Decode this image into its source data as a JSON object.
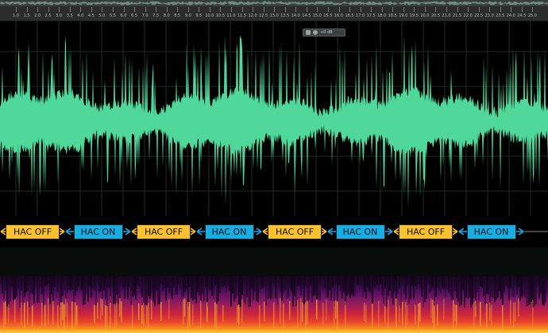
{
  "ruler": {
    "ticks": [
      "1.0",
      "1.5",
      "2.0",
      "2.5",
      "3.0",
      "3.5",
      "4.0",
      "4.5",
      "5.0",
      "5.5",
      "6.0",
      "6.5",
      "7.0",
      "7.5",
      "8.0",
      "8.5",
      "9.0",
      "9.5",
      "10.0",
      "10.5",
      "11.0",
      "11.5",
      "12.0",
      "12.5",
      "13.0",
      "13.5",
      "14.0",
      "14.5",
      "15.0",
      "15.5",
      "16.0",
      "16.5",
      "17.0",
      "17.5",
      "18.0",
      "18.5",
      "19.0",
      "19.5",
      "20.0",
      "20.5",
      "21.0",
      "21.5",
      "22.0",
      "22.5",
      "23.0",
      "23.5",
      "24.0",
      "24.5",
      "25.0"
    ]
  },
  "hud": {
    "label": "+0 dB"
  },
  "markers": {
    "segments": [
      {
        "label": "HAC OFF",
        "state": "off"
      },
      {
        "label": "HAC ON",
        "state": "on"
      },
      {
        "label": "HAC OFF",
        "state": "off"
      },
      {
        "label": "HAC ON",
        "state": "on"
      },
      {
        "label": "HAC OFF",
        "state": "off"
      },
      {
        "label": "HAC ON",
        "state": "on"
      },
      {
        "label": "HAC OFF",
        "state": "off"
      },
      {
        "label": "HAC ON",
        "state": "on"
      }
    ]
  },
  "colors": {
    "waveform": "#4fd89a",
    "hac_off": "#f9c12e",
    "hac_on": "#17aee3",
    "arrow_off": "#f9c12e",
    "arrow_on": "#17aee3"
  }
}
